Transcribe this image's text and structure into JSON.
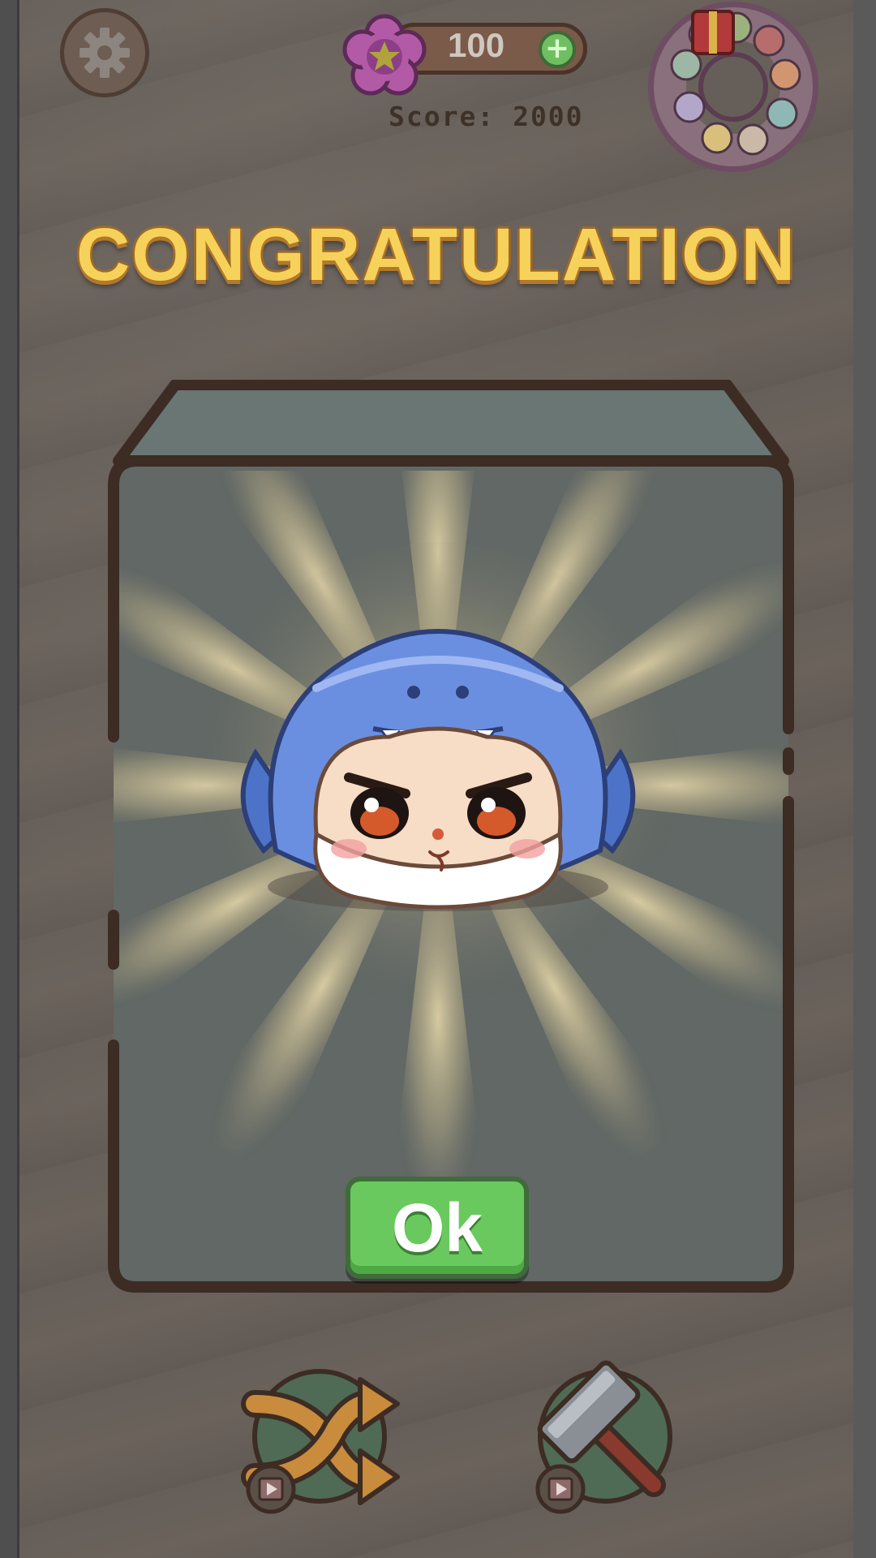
{
  "top_bar": {
    "currency_value": "100",
    "score_text": "Score: 2000",
    "settings_icon": "gear-icon",
    "currency_icon": "star-flower-icon",
    "add_icon": "plus-icon",
    "collection_icon": "character-wreath-icon"
  },
  "dialog": {
    "title": "CONGRATULATION",
    "ok_label": "Ok",
    "character": "blue-shark-hood-character"
  },
  "tools": {
    "shuffle_icon": "shuffle-arrows-icon",
    "hammer_icon": "hammer-icon",
    "video_ad_icon": "video-play-icon"
  },
  "colors": {
    "title": "#f7d25a",
    "ok_button": "#69c95e",
    "background": "#665f59"
  }
}
